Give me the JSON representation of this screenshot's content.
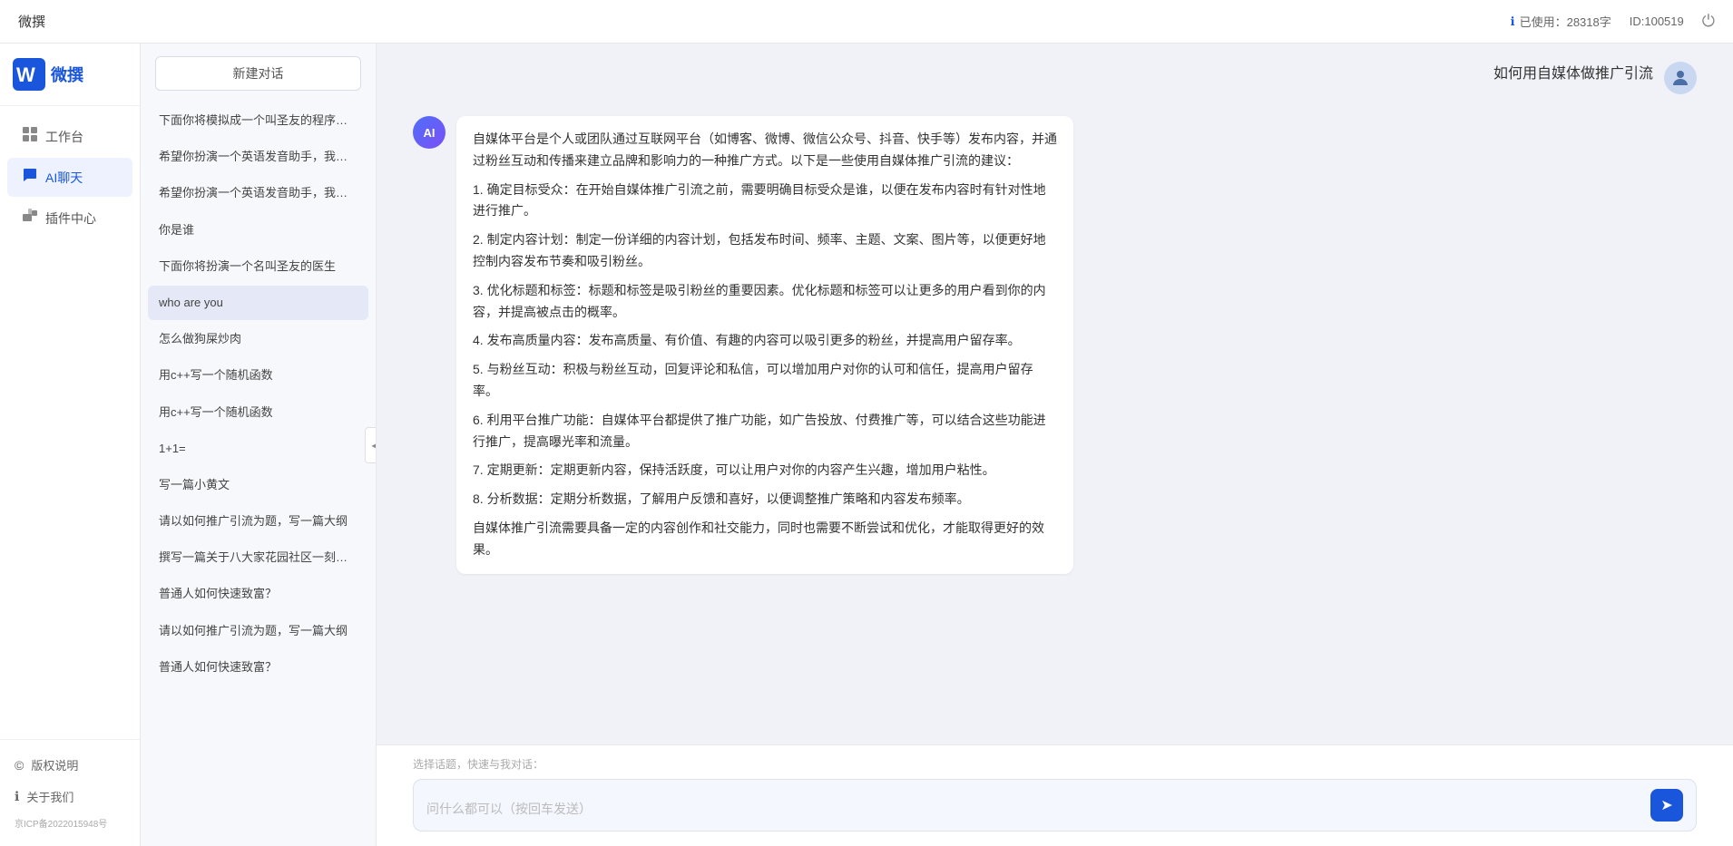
{
  "topbar": {
    "title": "微撰",
    "usage_label": "已使用：28318字",
    "id_label": "ID:100519",
    "usage_icon": "ℹ",
    "logout_icon": "⏻"
  },
  "sidebar": {
    "logo_text": "微撰",
    "nav_items": [
      {
        "id": "workbench",
        "label": "工作台",
        "icon": "⊞"
      },
      {
        "id": "ai-chat",
        "label": "AI聊天",
        "icon": "💬"
      },
      {
        "id": "plugin-center",
        "label": "插件中心",
        "icon": "🧩"
      }
    ],
    "bottom_items": [
      {
        "id": "copyright",
        "label": "版权说明",
        "icon": "©"
      },
      {
        "id": "about",
        "label": "关于我们",
        "icon": "ℹ"
      }
    ],
    "beian": "京ICP备2022015948号"
  },
  "history": {
    "new_chat_label": "新建对话",
    "items": [
      {
        "id": 1,
        "text": "下面你将模拟成一个叫圣友的程序员，我说...",
        "selected": false
      },
      {
        "id": 2,
        "text": "希望你扮演一个英语发音助手，我提供给你...",
        "selected": false
      },
      {
        "id": 3,
        "text": "希望你扮演一个英语发音助手，我提供给你...",
        "selected": false
      },
      {
        "id": 4,
        "text": "你是谁",
        "selected": false
      },
      {
        "id": 5,
        "text": "下面你将扮演一个名叫圣友的医生",
        "selected": false
      },
      {
        "id": 6,
        "text": "who are you",
        "selected": true
      },
      {
        "id": 7,
        "text": "怎么做狗屎炒肉",
        "selected": false
      },
      {
        "id": 8,
        "text": "用c++写一个随机函数",
        "selected": false
      },
      {
        "id": 9,
        "text": "用c++写一个随机函数",
        "selected": false
      },
      {
        "id": 10,
        "text": "1+1=",
        "selected": false
      },
      {
        "id": 11,
        "text": "写一篇小黄文",
        "selected": false
      },
      {
        "id": 12,
        "text": "请以如何推广引流为题，写一篇大纲",
        "selected": false
      },
      {
        "id": 13,
        "text": "撰写一篇关于八大家花园社区一刻钟便民生...",
        "selected": false
      },
      {
        "id": 14,
        "text": "普通人如何快速致富？",
        "selected": false
      },
      {
        "id": 15,
        "text": "请以如何推广引流为题，写一篇大纲",
        "selected": false
      },
      {
        "id": 16,
        "text": "普通人如何快速致富？",
        "selected": false
      }
    ]
  },
  "chat": {
    "user_question": "如何用自媒体做推广引流",
    "ai_response": {
      "paragraphs": [
        "自媒体平台是个人或团队通过互联网平台（如博客、微博、微信公众号、抖音、快手等）发布内容，并通过粉丝互动和传播来建立品牌和影响力的一种推广方式。以下是一些使用自媒体推广引流的建议：",
        "1. 确定目标受众：在开始自媒体推广引流之前，需要明确目标受众是谁，以便在发布内容时有针对性地进行推广。",
        "2. 制定内容计划：制定一份详细的内容计划，包括发布时间、频率、主题、文案、图片等，以便更好地控制内容发布节奏和吸引粉丝。",
        "3. 优化标题和标签：标题和标签是吸引粉丝的重要因素。优化标题和标签可以让更多的用户看到你的内容，并提高被点击的概率。",
        "4. 发布高质量内容：发布高质量、有价值、有趣的内容可以吸引更多的粉丝，并提高用户留存率。",
        "5. 与粉丝互动：积极与粉丝互动，回复评论和私信，可以增加用户对你的认可和信任，提高用户留存率。",
        "6. 利用平台推广功能：自媒体平台都提供了推广功能，如广告投放、付费推广等，可以结合这些功能进行推广，提高曝光率和流量。",
        "7. 定期更新：定期更新内容，保持活跃度，可以让用户对你的内容产生兴趣，增加用户粘性。",
        "8. 分析数据：定期分析数据，了解用户反馈和喜好，以便调整推广策略和内容发布频率。",
        "自媒体推广引流需要具备一定的内容创作和社交能力，同时也需要不断尝试和优化，才能取得更好的效果。"
      ]
    }
  },
  "input": {
    "quick_topics_label": "选择话题，快速与我对话：",
    "placeholder": "问什么都可以（按回车发送）",
    "send_icon": "➤"
  }
}
